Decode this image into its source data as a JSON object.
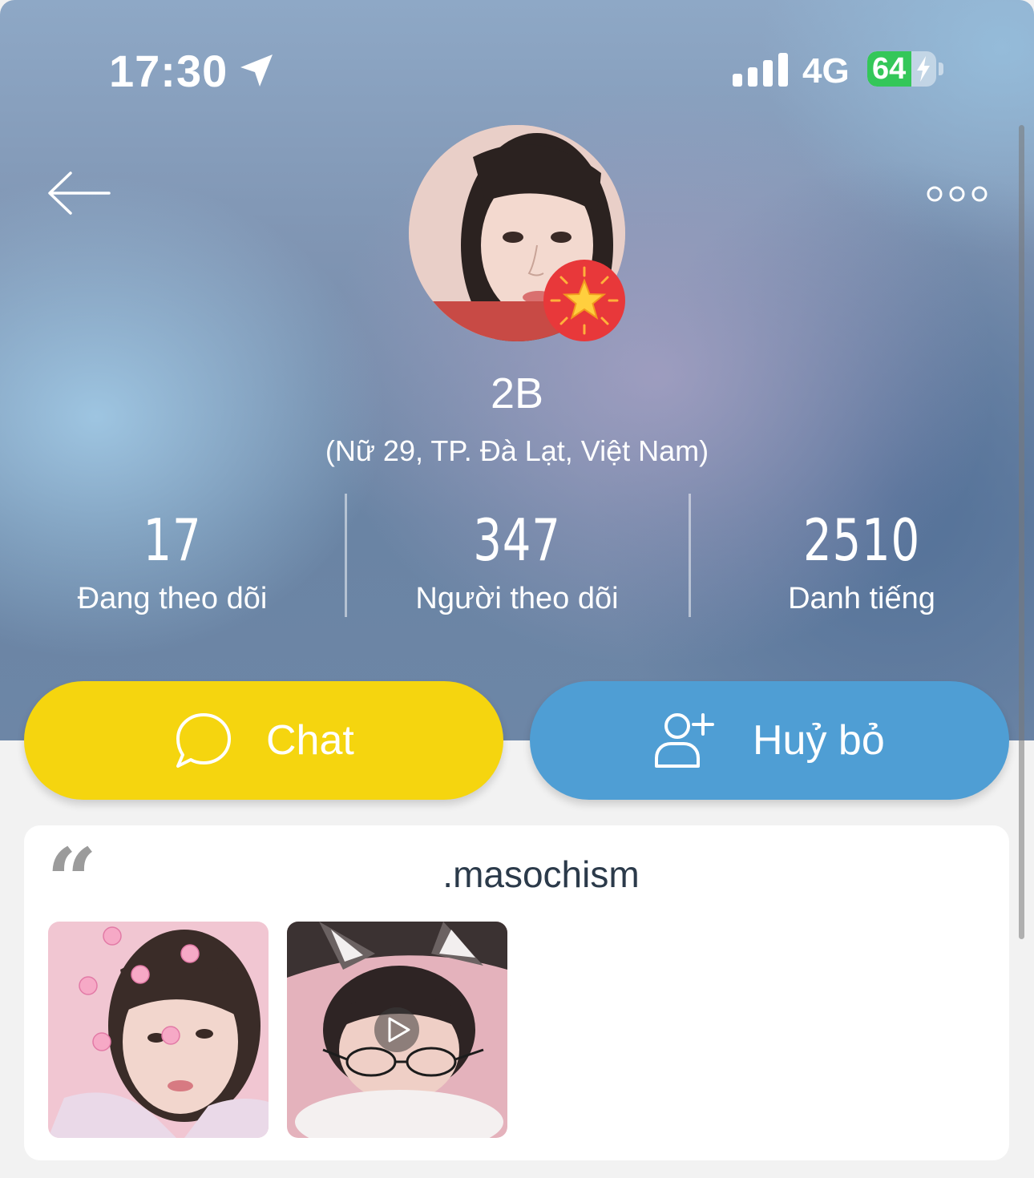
{
  "status_bar": {
    "time": "17:30",
    "network": "4G",
    "battery_percent": "64",
    "battery_level": 0.64,
    "icons": [
      "location-arrow-icon",
      "signal-bars-icon",
      "battery-charging-icon"
    ]
  },
  "header": {
    "back_icon": "arrow-left-icon",
    "more_icon": "more-dots-icon"
  },
  "profile": {
    "name": "2B",
    "info": "(Nữ 29, TP. Đà Lạt, Việt Nam)",
    "badge_icon": "star-badge-icon"
  },
  "stats": [
    {
      "value": "17",
      "label": "Đang theo dõi"
    },
    {
      "value": "347",
      "label": "Người theo dõi"
    },
    {
      "value": "2510",
      "label": "Danh tiếng"
    }
  ],
  "actions": {
    "chat_label": "Chat",
    "chat_icon": "chat-bubble-icon",
    "cancel_label": "Huỷ bỏ",
    "cancel_icon": "add-user-icon"
  },
  "quote": {
    "mark": "“",
    "text": ".masochism"
  },
  "photos": [
    {
      "icon": "photo-thumbnail",
      "is_video": false
    },
    {
      "icon": "video-thumbnail",
      "is_video": true
    }
  ],
  "colors": {
    "chat_button": "#f5d50f",
    "cancel_button": "#4f9ed4",
    "badge": "#e8383a",
    "battery_fill": "#34c759",
    "quote_text": "#2b3a4a"
  }
}
